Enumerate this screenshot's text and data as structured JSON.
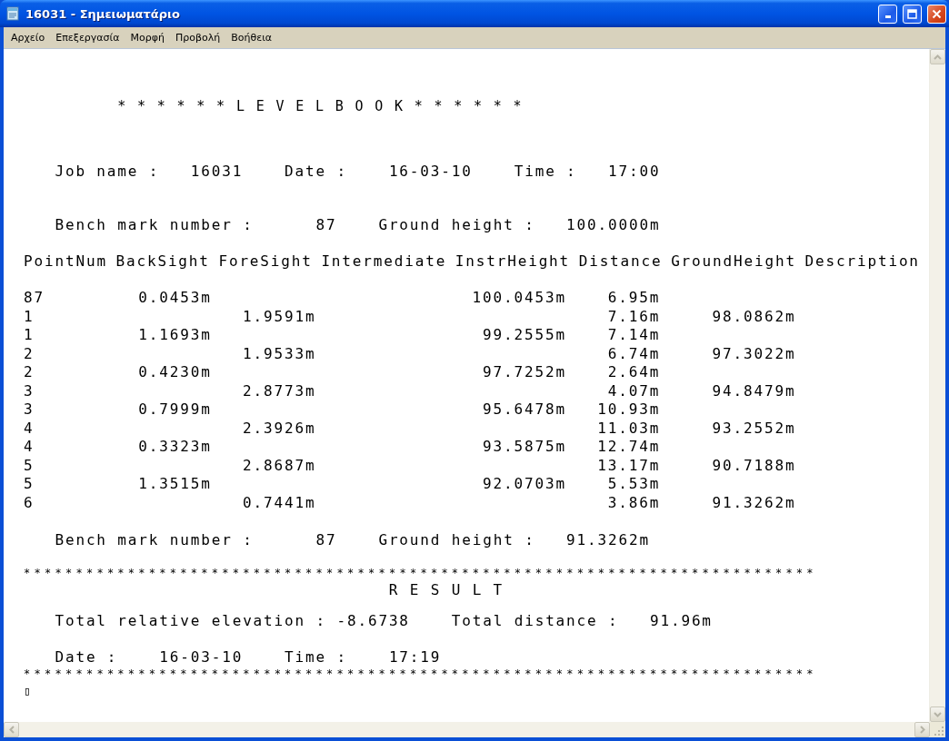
{
  "window": {
    "title": "16031 - Σημειωματάριο"
  },
  "menu": [
    "Αρχείο",
    "Επεξεργασία",
    "Μορφή",
    "Προβολή",
    "Βοήθεια"
  ],
  "document": {
    "banner": "* * * * * * L E V E L B O O K * * * * * *",
    "job_line": "Job name :   16031    Date :    16-03-10    Time :   17:00",
    "bench_line_start": "Bench mark number :      87    Ground height :   100.0000m",
    "columns": [
      "PointNum",
      "BackSight",
      "ForeSight",
      "Intermediate",
      "InstrHeight",
      "Distance",
      "GroundHeight",
      "Description"
    ],
    "rows": [
      {
        "point": "87",
        "backsight": "0.0453m",
        "instr_height": "100.0453m",
        "distance": "6.95m"
      },
      {
        "point": "1",
        "foresight": "1.9591m",
        "distance": "7.16m",
        "ground_height": "98.0862m"
      },
      {
        "point": "1",
        "backsight": "1.1693m",
        "instr_height": "99.2555m",
        "distance": "7.14m"
      },
      {
        "point": "2",
        "foresight": "1.9533m",
        "distance": "6.74m",
        "ground_height": "97.3022m"
      },
      {
        "point": "2",
        "backsight": "0.4230m",
        "instr_height": "97.7252m",
        "distance": "2.64m"
      },
      {
        "point": "3",
        "foresight": "2.8773m",
        "distance": "4.07m",
        "ground_height": "94.8479m"
      },
      {
        "point": "3",
        "backsight": "0.7999m",
        "instr_height": "95.6478m",
        "distance": "10.93m"
      },
      {
        "point": "4",
        "foresight": "2.3926m",
        "distance": "11.03m",
        "ground_height": "93.2552m"
      },
      {
        "point": "4",
        "backsight": "0.3323m",
        "instr_height": "93.5875m",
        "distance": "12.74m"
      },
      {
        "point": "5",
        "foresight": "2.8687m",
        "distance": "13.17m",
        "ground_height": "90.7188m"
      },
      {
        "point": "5",
        "backsight": "1.3515m",
        "instr_height": "92.0703m",
        "distance": "5.53m"
      },
      {
        "point": "6",
        "foresight": "0.7441m",
        "distance": "3.86m",
        "ground_height": "91.3262m"
      }
    ],
    "bench_line_end": "Bench mark number :      87    Ground height :   91.3262m",
    "separator_top": "****************************************************************************",
    "result_title": "R E S U L T",
    "totals_line": "Total relative elevation : -8.6738    Total distance :   91.96m",
    "date_line": "Date :    16-03-10    Time :    17:19",
    "separator_bottom": "****************************************************************************",
    "cursor": "▯"
  }
}
